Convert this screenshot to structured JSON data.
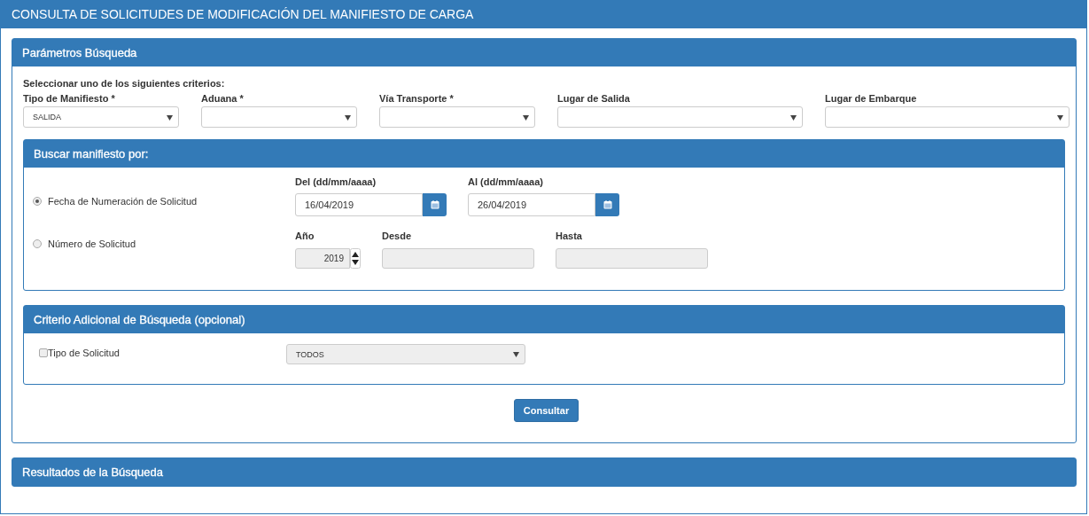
{
  "window": {
    "title": "CONSULTA DE SOLICITUDES DE MODIFICACIÓN DEL MANIFIESTO DE CARGA"
  },
  "search_params": {
    "title": "Parámetros Búsqueda",
    "instruction": "Seleccionar uno de los siguientes criterios:",
    "fields": [
      {
        "label": "Tipo de Manifiesto *",
        "value": "SALIDA"
      },
      {
        "label": "Aduana *"
      },
      {
        "label": "Vía Transporte *"
      },
      {
        "label": "Lugar de Salida"
      },
      {
        "label": "Lugar de Embarque"
      }
    ],
    "search_by": {
      "title": "Buscar manifiesto por:",
      "options": [
        {
          "label": "Fecha de Numeración de Solicitud",
          "selected": true,
          "inputs": [
            {
              "kind": "date",
              "label": "Del (dd/mm/aaaa)",
              "value": "16/04/2019",
              "disabled": false
            },
            {
              "kind": "date",
              "label": "Al (dd/mm/aaaa)",
              "value": "26/04/2019",
              "disabled": false
            }
          ]
        },
        {
          "label": "Número de Solicitud",
          "selected": false,
          "inputs": [
            {
              "kind": "spinner",
              "label": "Año",
              "value": "2019",
              "disabled": true
            },
            {
              "kind": "text",
              "label": "Desde",
              "disabled": true
            },
            {
              "kind": "text",
              "label": "Hasta",
              "disabled": true
            }
          ]
        }
      ]
    },
    "additional": {
      "title": "Criterio Adicional de Búsqueda (opcional)",
      "checkbox": {
        "label": "Tipo de Solicitud",
        "checked": false
      },
      "select": {
        "value": "TODOS",
        "disabled": true
      }
    },
    "submit": {
      "label": "Consultar"
    }
  },
  "results": {
    "title": "Resultados de la Búsqueda"
  }
}
